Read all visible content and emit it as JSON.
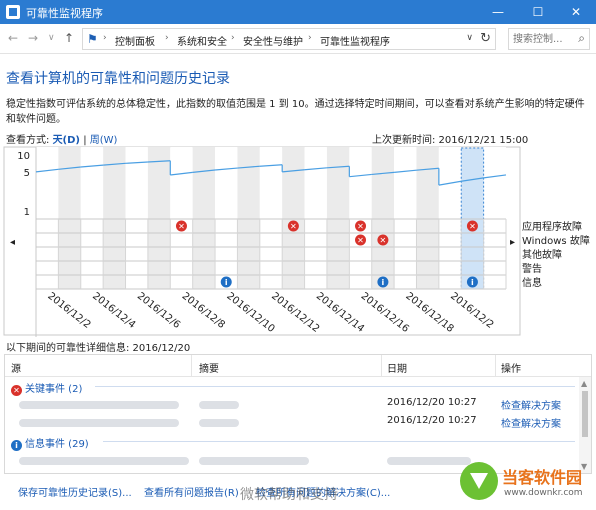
{
  "window": {
    "title": "可靠性监视程序",
    "min": "—",
    "max": "☐",
    "close": "✕"
  },
  "nav": {
    "back": "←",
    "forward": "→",
    "dropdown": "∨",
    "up": "↑"
  },
  "breadcrumb": [
    "控制面板",
    "系统和安全",
    "安全性与维护",
    "可靠性监视程序"
  ],
  "search": {
    "placeholder": "搜索控制..."
  },
  "page": {
    "title": "查看计算机的可靠性和问题历史记录",
    "description": "稳定性指数可评估系统的总体稳定性，此指数的取值范围是 1 到 10。通过选择特定时间期间，可以查看对系统产生影响的特定硬件和软件问题。",
    "view_by_label": "查看方式:",
    "view_day": "天(D)",
    "view_sep": "|",
    "view_week": "周(W)",
    "last_updated": "上次更新时间: 2016/12/21 15:00"
  },
  "chart_data": {
    "type": "line",
    "y_ticks": [
      10,
      5,
      1
    ],
    "ylim": [
      1,
      10
    ],
    "days": 21,
    "x_labels": [
      "2016/12/2",
      "2016/12/4",
      "2016/12/6",
      "2016/12/8",
      "2016/12/10",
      "2016/12/12",
      "2016/12/14",
      "2016/12/16",
      "2016/12/18",
      "2016/12/2"
    ],
    "stability_index": [
      [
        5.0,
        5.55
      ],
      [
        5.55,
        6.1
      ],
      [
        6.1,
        6.6
      ],
      [
        6.6,
        7.1
      ],
      [
        7.1,
        7.5
      ],
      [
        7.5,
        7.9
      ],
      [
        4.4,
        4.9
      ],
      [
        4.9,
        5.4
      ],
      [
        5.4,
        5.85
      ],
      [
        5.85,
        6.3
      ],
      [
        6.3,
        6.7
      ],
      [
        5.0,
        5.45
      ],
      [
        5.45,
        5.9
      ],
      [
        5.9,
        6.3
      ],
      [
        4.1,
        4.5
      ],
      [
        4.5,
        4.9
      ],
      [
        4.9,
        5.35
      ],
      [
        5.35,
        5.8
      ],
      [
        2.9,
        3.4
      ],
      [
        3.4,
        3.9
      ],
      [
        3.9,
        4.4
      ]
    ],
    "row_labels": [
      "应用程序故障",
      "Windows 故障",
      "其他故障",
      "警告",
      "信息"
    ],
    "critical_events": [
      {
        "day": 6,
        "row": 0
      },
      {
        "day": 11,
        "row": 0
      },
      {
        "day": 14,
        "row": 0
      },
      {
        "day": 14,
        "row": 1
      },
      {
        "day": 15,
        "row": 1
      },
      {
        "day": 19,
        "row": 0
      }
    ],
    "info_events": [
      {
        "day": 8,
        "row": 4
      },
      {
        "day": 15,
        "row": 4
      },
      {
        "day": 19,
        "row": 4
      }
    ],
    "selected_day": 19,
    "colors": {
      "line": "#4a9fe3",
      "critical": "#d9322b",
      "info": "#1f6fc5",
      "selected": "#cfe3f7"
    }
  },
  "details": {
    "title": "以下期间的可靠性详细信息: 2016/12/20",
    "columns": [
      "源",
      "摘要",
      "日期",
      "操作"
    ],
    "groups": [
      {
        "label": "关键事件 (2)",
        "rows": [
          {
            "date": "2016/12/20 10:27",
            "action": "检查解决方案"
          },
          {
            "date": "2016/12/20 10:27",
            "action": "检查解决方案"
          }
        ]
      },
      {
        "label": "信息事件 (29)"
      }
    ]
  },
  "bottom_links": [
    "保存可靠性历史记录(S)...",
    "查看所有问题报告(R)",
    "检查所有问题的解决方案(C)..."
  ],
  "watermark": "微软帮助和支持",
  "logo": {
    "name": "当客软件园",
    "url": "www.downkr.com"
  }
}
